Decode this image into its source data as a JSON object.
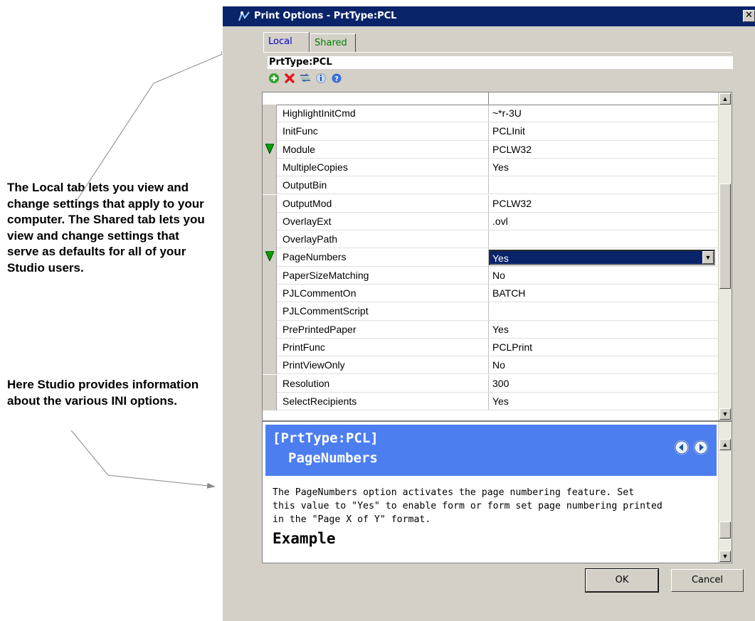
{
  "annotations": {
    "local_tab_note": "The Local tab lets you view and change settings that apply to your computer. The Shared tab lets you view and change settings that serve as defaults for all of your Studio users.",
    "help_note": "Here Studio provides information about the various INI options."
  },
  "dialog": {
    "title": "Print Options - PrtType:PCL",
    "close_glyph": "✕",
    "tabs": [
      {
        "label": "Local",
        "active": true,
        "color": "#0000d0"
      },
      {
        "label": "Shared",
        "active": false,
        "color": "#008000"
      }
    ],
    "section_title": "PrtType:PCL",
    "toolbar": [
      "add-icon",
      "delete-icon",
      "edit-icon",
      "info-icon",
      "help-icon"
    ],
    "rows": [
      {
        "name": "HighlightInitCmd",
        "value": "~*r-3U",
        "marked": false
      },
      {
        "name": "InitFunc",
        "value": "PCLInit",
        "marked": false
      },
      {
        "name": "Module",
        "value": "PCLW32",
        "marked": true
      },
      {
        "name": "MultipleCopies",
        "value": "Yes",
        "marked": false
      },
      {
        "name": "OutputBin",
        "value": "",
        "marked": false
      },
      {
        "name": "OutputMod",
        "value": "PCLW32",
        "marked": false
      },
      {
        "name": "OverlayExt",
        "value": ".ovl",
        "marked": false
      },
      {
        "name": "OverlayPath",
        "value": "",
        "marked": false
      },
      {
        "name": "PageNumbers",
        "value": "Yes",
        "marked": true,
        "editing": true
      },
      {
        "name": "PaperSizeMatching",
        "value": "No",
        "marked": false
      },
      {
        "name": "PJLCommentOn",
        "value": "BATCH",
        "marked": false
      },
      {
        "name": "PJLCommentScript",
        "value": "",
        "marked": false
      },
      {
        "name": "PrePrintedPaper",
        "value": "Yes",
        "marked": false
      },
      {
        "name": "PrintFunc",
        "value": "PCLPrint",
        "marked": false
      },
      {
        "name": "PrintViewOnly",
        "value": "No",
        "marked": false
      },
      {
        "name": "Resolution",
        "value": "300",
        "marked": false
      },
      {
        "name": "SelectRecipients",
        "value": "Yes",
        "marked": false
      }
    ],
    "help": {
      "section": "[PrtType:PCL]",
      "option": "PageNumbers",
      "description_lines": [
        "The PageNumbers option activates the page numbering feature. Set",
        "this value to \"Yes\" to enable form or form set page numbering printed",
        "in the \"Page X of Y\" format."
      ],
      "subheading": "Example",
      "header_color": "#4d7ef0"
    },
    "buttons": {
      "ok": "OK",
      "cancel": "Cancel"
    }
  },
  "colors": {
    "titlebar": "#0a246a",
    "marker": "#00a000",
    "selection": "#0a246a"
  }
}
